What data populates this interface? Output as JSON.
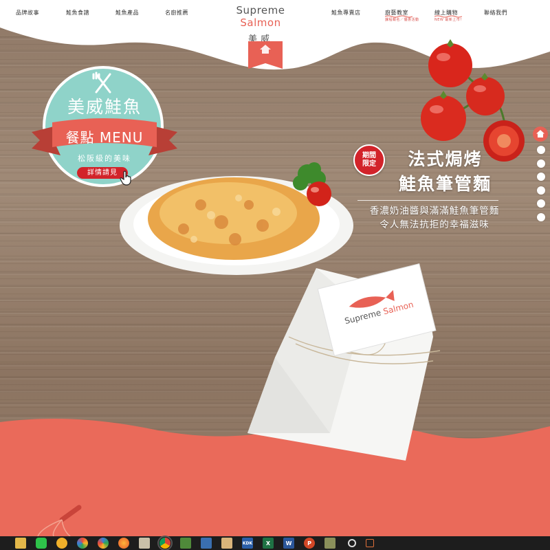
{
  "nav": {
    "items": [
      {
        "label": "品牌故事"
      },
      {
        "label": "鮭魚食譜"
      },
      {
        "label": "鮭魚產品"
      },
      {
        "label": "名廚推薦"
      },
      {
        "label": "鮭魚專賣店"
      },
      {
        "label": "廚藝教室",
        "sub": "課程報名／優惠活動"
      },
      {
        "label": "線上購物",
        "sub": "NEW 最新上市！"
      },
      {
        "label": "聯絡我們"
      }
    ],
    "brand_en_1": "Supreme",
    "brand_en_2": "Salmon",
    "brand_zh": "美威"
  },
  "badge": {
    "title": "美威鮭魚",
    "ribbon": "餐點 MENU",
    "tagline": "松阪級的美味",
    "button": "詳情請見"
  },
  "promo": {
    "limited_1": "期間",
    "limited_2": "限定",
    "title_1": "法式焗烤",
    "title_2": "鮭魚筆管麵",
    "desc_1": "香濃奶油醬與滿滿鮭魚筆管麵",
    "desc_2": "令人無法抗拒的幸福滋味"
  },
  "napkin_tag": {
    "brand_1": "Supreme",
    "brand_2": "Salmon"
  },
  "side_nav": {
    "dot_count": 6
  },
  "colors": {
    "accent": "#e86155",
    "limited_red": "#d2232a",
    "badge_teal": "#8fd3c9",
    "wood": "#9a8370"
  },
  "taskbar": {
    "icons": [
      "windows-icon",
      "explorer-icon",
      "line-icon",
      "crayon-icon",
      "pinwheel-icon",
      "firefox-icon",
      "notepad-icon",
      "chrome-icon",
      "bucket-icon",
      "save-icon",
      "paint-icon",
      "kdk-icon",
      "excel-icon",
      "word-icon",
      "powerpoint-icon",
      "archive-icon",
      "sync-icon",
      "projector-icon"
    ],
    "labels": {
      "kdk": "KDK",
      "excel": "X",
      "word": "W",
      "powerpoint": "P"
    }
  }
}
